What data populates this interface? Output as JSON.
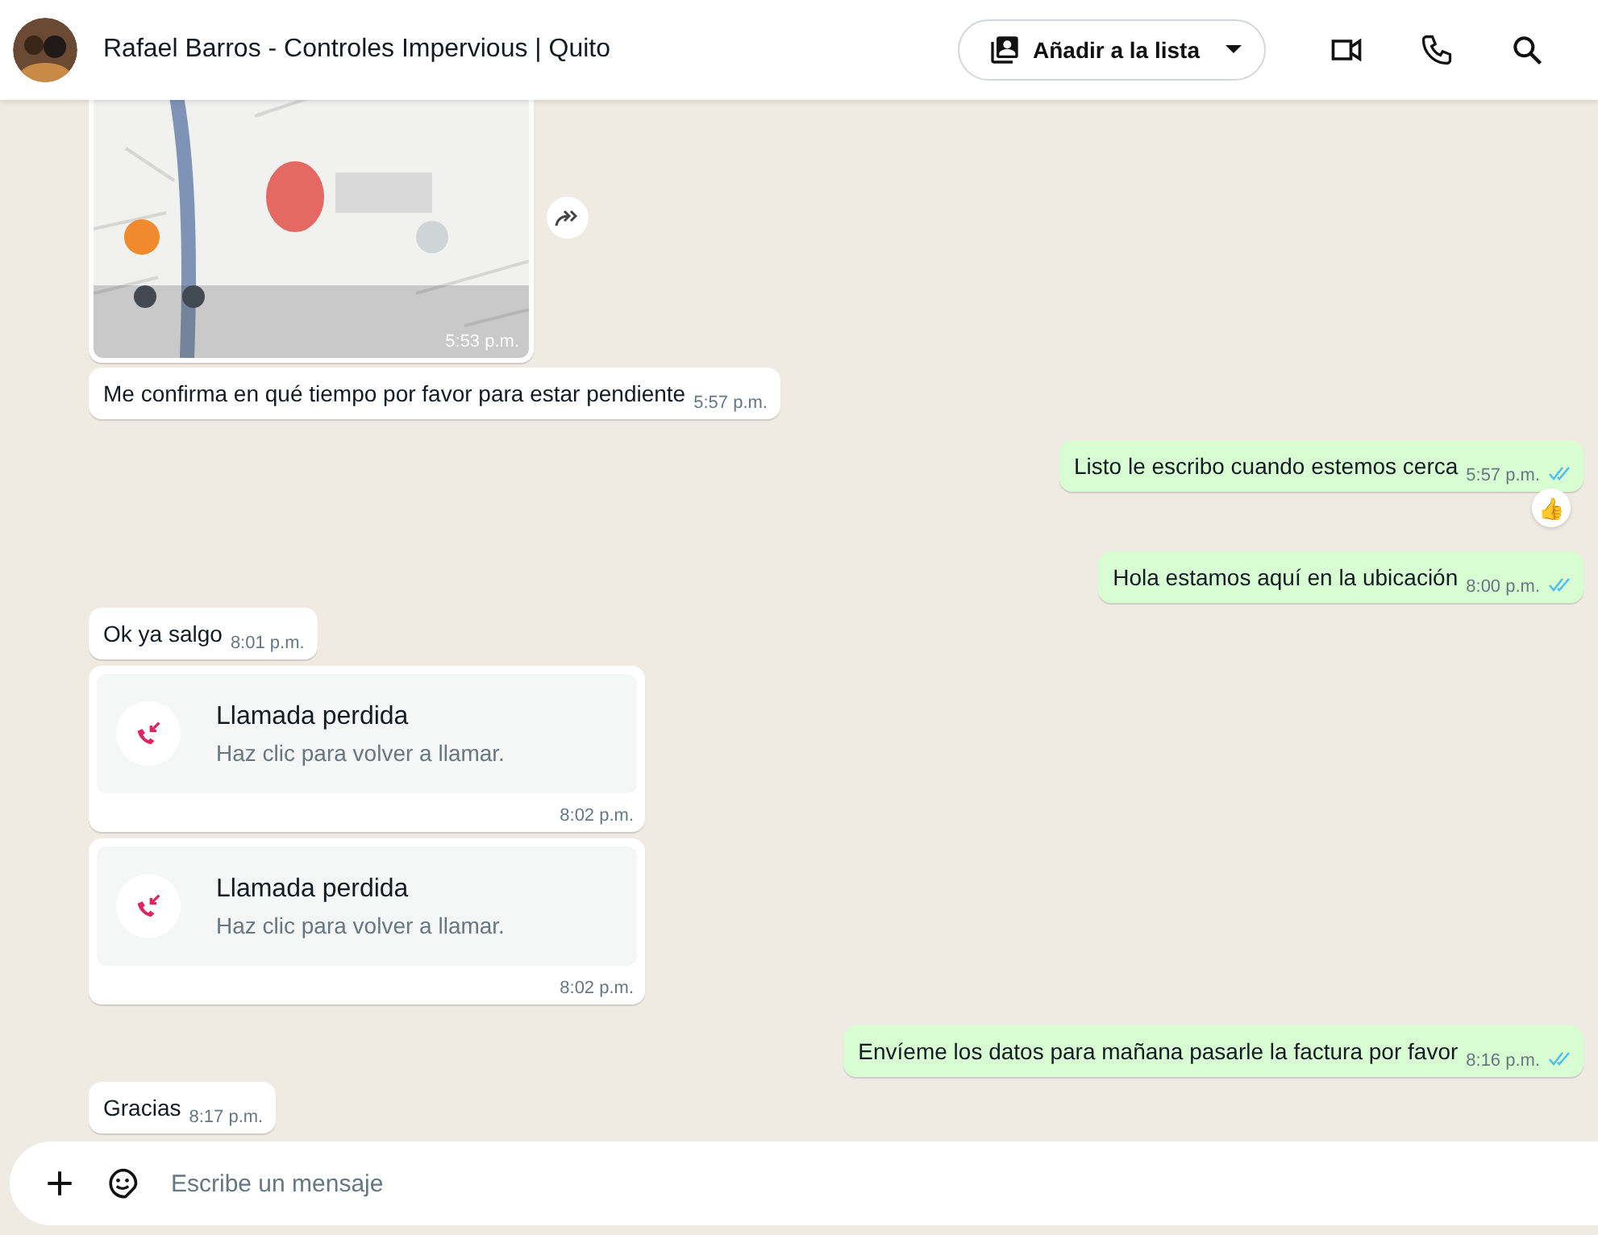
{
  "header": {
    "contact_name": "Rafael Barros - Controles Impervious | Quito",
    "list_button": "Añadir a la lista"
  },
  "messages": [
    {
      "kind": "map",
      "outgoing": false,
      "time": "5:53 p.m."
    },
    {
      "kind": "text",
      "outgoing": false,
      "text": "Me confirma en qué tiempo por favor para estar pendiente",
      "time": "5:57 p.m."
    },
    {
      "kind": "text",
      "outgoing": true,
      "text": "Listo le escribo cuando estemos cerca",
      "time": "5:57 p.m.",
      "read": true,
      "reaction": "👍"
    },
    {
      "kind": "text",
      "outgoing": true,
      "text": "Hola estamos aquí en la ubicación",
      "time": "8:00 p.m.",
      "read": true
    },
    {
      "kind": "text",
      "outgoing": false,
      "text": "Ok ya salgo",
      "time": "8:01 p.m."
    },
    {
      "kind": "call",
      "outgoing": false,
      "title": "Llamada perdida",
      "subtitle": "Haz clic para volver a llamar.",
      "time": "8:02 p.m."
    },
    {
      "kind": "call",
      "outgoing": false,
      "title": "Llamada perdida",
      "subtitle": "Haz clic para volver a llamar.",
      "time": "8:02 p.m."
    },
    {
      "kind": "text",
      "outgoing": true,
      "text": "Envíeme los datos para mañana pasarle la factura por favor",
      "time": "8:16 p.m.",
      "read": true
    },
    {
      "kind": "text",
      "outgoing": false,
      "text": "Gracias",
      "time": "8:17 p.m."
    }
  ],
  "composer": {
    "placeholder": "Escribe un mensaje"
  }
}
